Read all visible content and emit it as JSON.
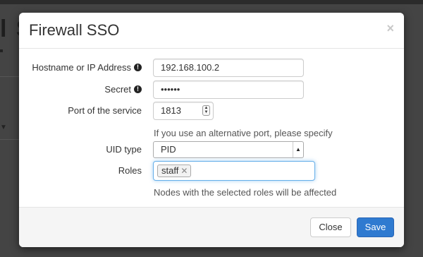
{
  "background": {
    "title_fragment": "l S"
  },
  "modal": {
    "title": "Firewall SSO",
    "close_glyph": "×",
    "fields": {
      "hostname": {
        "label": "Hostname or IP Address",
        "value": "192.168.100.2"
      },
      "secret": {
        "label": "Secret",
        "value": "••••••"
      },
      "port": {
        "label": "Port of the service",
        "value": "1813",
        "help": "If you use an alternative port, please specify"
      },
      "uid_type": {
        "label": "UID type",
        "selected": "PID"
      },
      "roles": {
        "label": "Roles",
        "tags": [
          "staff"
        ],
        "help": "Nodes with the selected roles will be affected"
      }
    },
    "info_glyph": "!",
    "footer": {
      "close_label": "Close",
      "save_label": "Save"
    }
  },
  "colors": {
    "primary_button": "#2f7ad0",
    "focus_border": "#66afe9"
  }
}
